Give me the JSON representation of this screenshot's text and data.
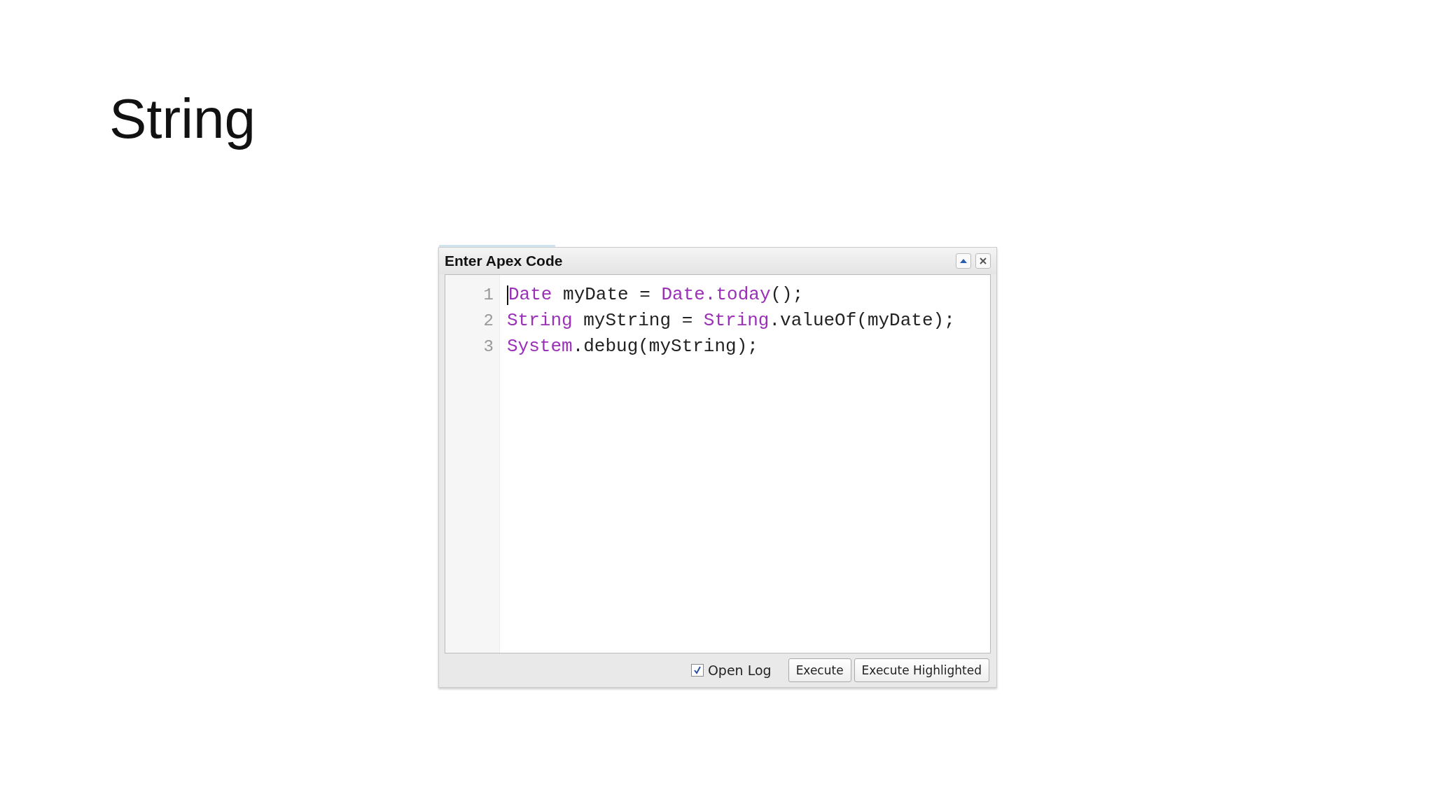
{
  "slide_title": "String",
  "dialog": {
    "title": "Enter Apex Code",
    "code_lines": [
      {
        "number": "1",
        "tokens": [
          {
            "text": "Date",
            "kind": "keyword"
          },
          {
            "text": " myDate = ",
            "kind": "plain"
          },
          {
            "text": "Date.today",
            "kind": "keyword"
          },
          {
            "text": "();",
            "kind": "plain"
          }
        ]
      },
      {
        "number": "2",
        "tokens": [
          {
            "text": "String",
            "kind": "keyword"
          },
          {
            "text": " myString = ",
            "kind": "plain"
          },
          {
            "text": "String",
            "kind": "keyword"
          },
          {
            "text": ".valueOf(myDate);",
            "kind": "plain"
          }
        ]
      },
      {
        "number": "3",
        "tokens": [
          {
            "text": "System",
            "kind": "keyword"
          },
          {
            "text": ".debug(myString);",
            "kind": "plain"
          }
        ]
      }
    ],
    "open_log": {
      "label": "Open Log",
      "checked": true
    },
    "buttons": [
      "Execute",
      "Execute Highlighted"
    ]
  }
}
